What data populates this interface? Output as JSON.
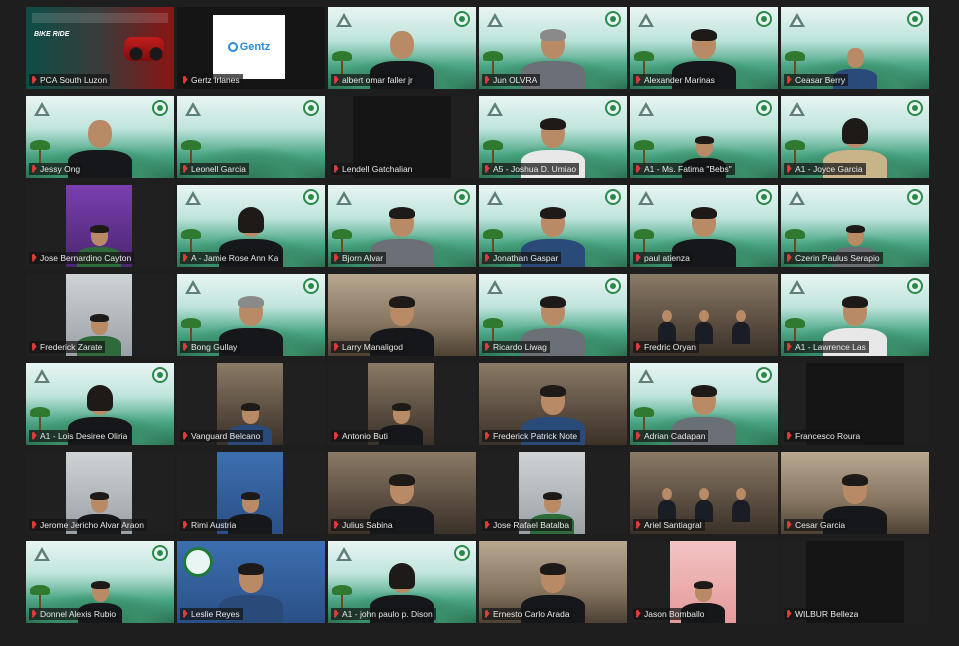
{
  "window": {
    "title": ""
  },
  "banner": {
    "title": "BIKE RIDE"
  },
  "brand": {
    "logo_text": "Gentz"
  },
  "participants": [
    {
      "name": "PCA South Luzon",
      "bg": "banner",
      "active": true
    },
    {
      "name": "Gertz Irlanes",
      "bg": "brand"
    },
    {
      "name": "albert omar faller jr",
      "bg": "green",
      "person": "bald b-black"
    },
    {
      "name": "Jun OLVRA",
      "bg": "green",
      "person": "gray-hair b-gray"
    },
    {
      "name": "Alexander Marinas",
      "bg": "green",
      "person": "b-black"
    },
    {
      "name": "Ceasar Berry",
      "bg": "green",
      "person": "bald b-blue small"
    },
    {
      "name": "Jessy Ong",
      "bg": "green",
      "person": "bald b-black"
    },
    {
      "name": "Leonell Garcia",
      "bg": "green",
      "person": "none"
    },
    {
      "name": "Lendell Gatchalian",
      "bg": "dark",
      "person": "none"
    },
    {
      "name": "A5 - Joshua D. Umiao",
      "bg": "green",
      "person": "b-white"
    },
    {
      "name": "A1 - Ms. Fatima \"Bebs\"",
      "bg": "green",
      "person": "b-black small"
    },
    {
      "name": "A1 - Joyce Garcia",
      "bg": "green",
      "person": "long-hair b-tan"
    },
    {
      "name": "Jose Bernardino Cayton",
      "bg": "purple",
      "person": "b-green small"
    },
    {
      "name": "A - Jamie Rose Ann Ka",
      "bg": "green",
      "person": "long-hair b-black"
    },
    {
      "name": "Bjorn Alvar",
      "bg": "green",
      "person": "b-gray"
    },
    {
      "name": "Jonathan Gaspar",
      "bg": "green",
      "person": "b-blue"
    },
    {
      "name": "paul atienza",
      "bg": "green",
      "person": "b-black"
    },
    {
      "name": "Czerin Paulus Serapio",
      "bg": "green",
      "person": "b-gray small"
    },
    {
      "name": "Frederick Zarate",
      "bg": "gray",
      "person": "b-green small"
    },
    {
      "name": "Bong Gullay",
      "bg": "green",
      "person": "gray-hair b-black"
    },
    {
      "name": "Larry Manaligod",
      "bg": "warm",
      "person": "b-black"
    },
    {
      "name": "Ricardo Liwag",
      "bg": "green",
      "person": "b-gray"
    },
    {
      "name": "Fredric Oryan",
      "bg": "room",
      "person": "group"
    },
    {
      "name": "A1 - Lawrence Las",
      "bg": "green",
      "person": "b-white"
    },
    {
      "name": "A1 - Lois Desiree Oliria",
      "bg": "green",
      "person": "long-hair b-black"
    },
    {
      "name": "Vanguard Belcano",
      "bg": "room",
      "person": "b-blue small"
    },
    {
      "name": "Antonio Buti",
      "bg": "room",
      "person": "b-black small"
    },
    {
      "name": "Frederick Patrick Note",
      "bg": "room",
      "person": "b-blue"
    },
    {
      "name": "Adrian Cadapan",
      "bg": "green",
      "person": "b-gray"
    },
    {
      "name": "Francesco Roura",
      "bg": "dark",
      "person": "none"
    },
    {
      "name": "Jerome Jericho Alvar Araon",
      "bg": "gray",
      "person": "b-black small"
    },
    {
      "name": "Rimi Austria",
      "bg": "blue",
      "person": "b-black small"
    },
    {
      "name": "Julius Sabina",
      "bg": "room",
      "person": "b-black"
    },
    {
      "name": "Jose Rafael Batalba",
      "bg": "gray",
      "person": "b-green small"
    },
    {
      "name": "Ariel Santiagral",
      "bg": "room",
      "person": "group"
    },
    {
      "name": "Cesar Garcia",
      "bg": "warm",
      "person": "b-black"
    },
    {
      "name": "Donnel Alexis Rubio",
      "bg": "green",
      "person": "b-black small"
    },
    {
      "name": "Leslie Reyes",
      "bg": "blue",
      "person": "b-blue"
    },
    {
      "name": "A1 - john paulo p. Dison",
      "bg": "green",
      "person": "long-hair b-black"
    },
    {
      "name": "Ernesto Carlo Arada",
      "bg": "warm",
      "person": "b-black"
    },
    {
      "name": "Jason Bomballo",
      "bg": "pink",
      "person": "b-black small"
    },
    {
      "name": "WILBUR Belleza",
      "bg": "dark",
      "person": "none"
    }
  ]
}
